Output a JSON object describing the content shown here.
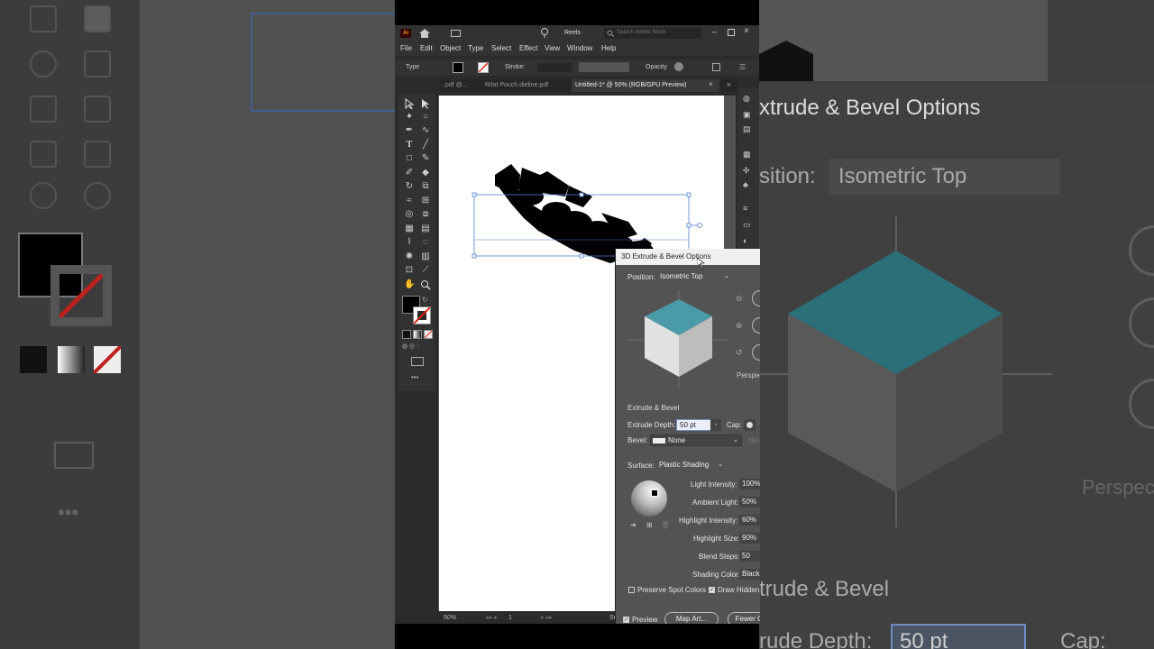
{
  "app": {
    "logo": "Ai",
    "workspace": "Reels",
    "search_placeholder": "Search Adobe Stock"
  },
  "menu": [
    "File",
    "Edit",
    "Object",
    "Type",
    "Select",
    "Effect",
    "View",
    "Window",
    "Help"
  ],
  "control_bar": {
    "type_label": "Type",
    "stroke_label": "Stroke:",
    "opacity_label": "Opacity"
  },
  "tabs": [
    {
      "label": "..pdf @..."
    },
    {
      "label": "Rifat Pouch dieline.pdf"
    },
    {
      "label": "Untitled-1* @ 50% (RGB/GPU Preview)"
    }
  ],
  "status": {
    "zoom": "50%",
    "artboard": "1",
    "truncated": "Se"
  },
  "dialog": {
    "title": "3D Extrude & Bevel Options",
    "position_label": "Position:",
    "position_value": "Isometric Top",
    "perspective_label": "Perspec",
    "section_extrude": "Extrude & Bevel",
    "extrude_depth_label": "Extrude Depth:",
    "extrude_depth_value": "50 pt",
    "cap_label": "Cap:",
    "bevel_label": "Bevel:",
    "bevel_value": "None",
    "bevel_height": "Hei",
    "surface_label": "Surface:",
    "surface_value": "Plastic Shading",
    "light_intensity_label": "Light Intensity:",
    "light_intensity_value": "100%",
    "ambient_light_label": "Ambient Light:",
    "ambient_light_value": "50%",
    "highlight_intensity_label": "Highlight Intensity:",
    "highlight_intensity_value": "60%",
    "highlight_size_label": "Highlight Size:",
    "highlight_size_value": "90%",
    "blend_steps_label": "Blend Steps:",
    "blend_steps_value": "50",
    "shading_color_label": "Shading Color:",
    "shading_color_value": "Black",
    "preserve_spot_label": "Preserve Spot Colors",
    "draw_hidden_label": "Draw Hidden",
    "preview_label": "Preview",
    "map_art_label": "Map Art...",
    "fewer_label": "Fewer O"
  },
  "background_zoom": {
    "title": "xtrude & Bevel Options",
    "position_label": "sition:",
    "position_value": "Isometric Top",
    "perspective": "Perspec",
    "section": "trude & Bevel",
    "depth_label": "rude Depth:",
    "depth_value": "50 pt",
    "cap": "Cap:"
  },
  "colors": {
    "cube_top": "#4a9aa8",
    "cube_left": "#e2e2e2",
    "cube_right": "#bdbdbd",
    "selection": "#4f7fd0",
    "dialog_bg": "#535353"
  }
}
